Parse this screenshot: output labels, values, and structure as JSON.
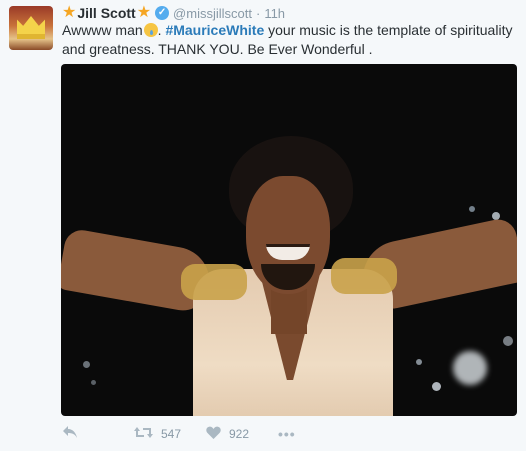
{
  "tweet": {
    "author": {
      "display_name": "Jill Scott",
      "star_emoji": "★",
      "handle": "@missjillscott",
      "time": "11h",
      "verified_mark": "✓"
    },
    "text": {
      "part1": "Awwww man",
      "part2": ". ",
      "hashtag": "#MauriceWhite",
      "part3": " your music is the template of spirituality and greatness. THANK YOU. Be Ever Wonderful ."
    },
    "actions": {
      "retweet_count": "547",
      "like_count": "922",
      "more": "•••"
    }
  },
  "icons": {
    "reply": "reply-icon",
    "retweet": "retweet-icon",
    "like": "heart-icon",
    "more": "more-icon"
  },
  "colors": {
    "link": "#2b7bb9",
    "secondary_text": "#8899a6",
    "verified": "#55acee",
    "star": "#f5a623"
  }
}
